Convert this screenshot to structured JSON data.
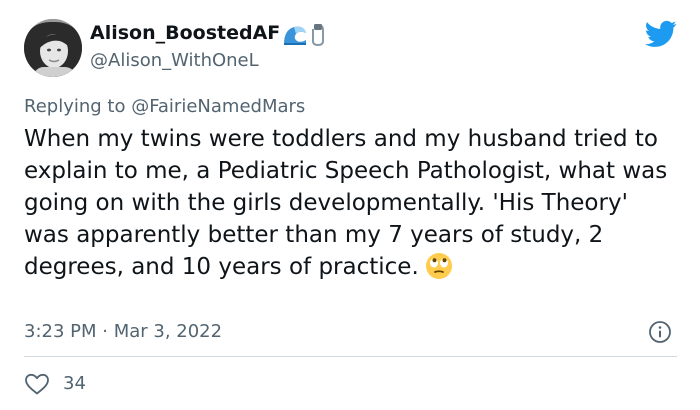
{
  "author": {
    "display_name": "Alison_BoostedAF",
    "handle": "@Alison_WithOneL"
  },
  "reply": {
    "prefix": "Replying to ",
    "mention": "@FairieNamedMars"
  },
  "tweet": {
    "text": "When my twins were toddlers and my husband tried to explain to me, a Pediatric Speech Pathologist, what was going on with the girls developmentally. 'His Theory' was apparently better than my 7 years of study, 2 degrees, and 10 years of practice."
  },
  "meta": {
    "timestamp": "3:23 PM · Mar 3, 2022"
  },
  "engagement": {
    "likes": "34"
  },
  "icons": {
    "brand": "twitter-bird-icon",
    "name_emojis": [
      "wave-emoji-icon",
      "safety-pin-emoji-icon"
    ],
    "text_emoji": "face-with-rolling-eyes-icon",
    "info": "info-icon",
    "like": "heart-icon"
  },
  "colors": {
    "brand_blue": "#1d9bf0",
    "text_primary": "#0f1419",
    "text_secondary": "#536471",
    "divider": "#cfd9de"
  }
}
